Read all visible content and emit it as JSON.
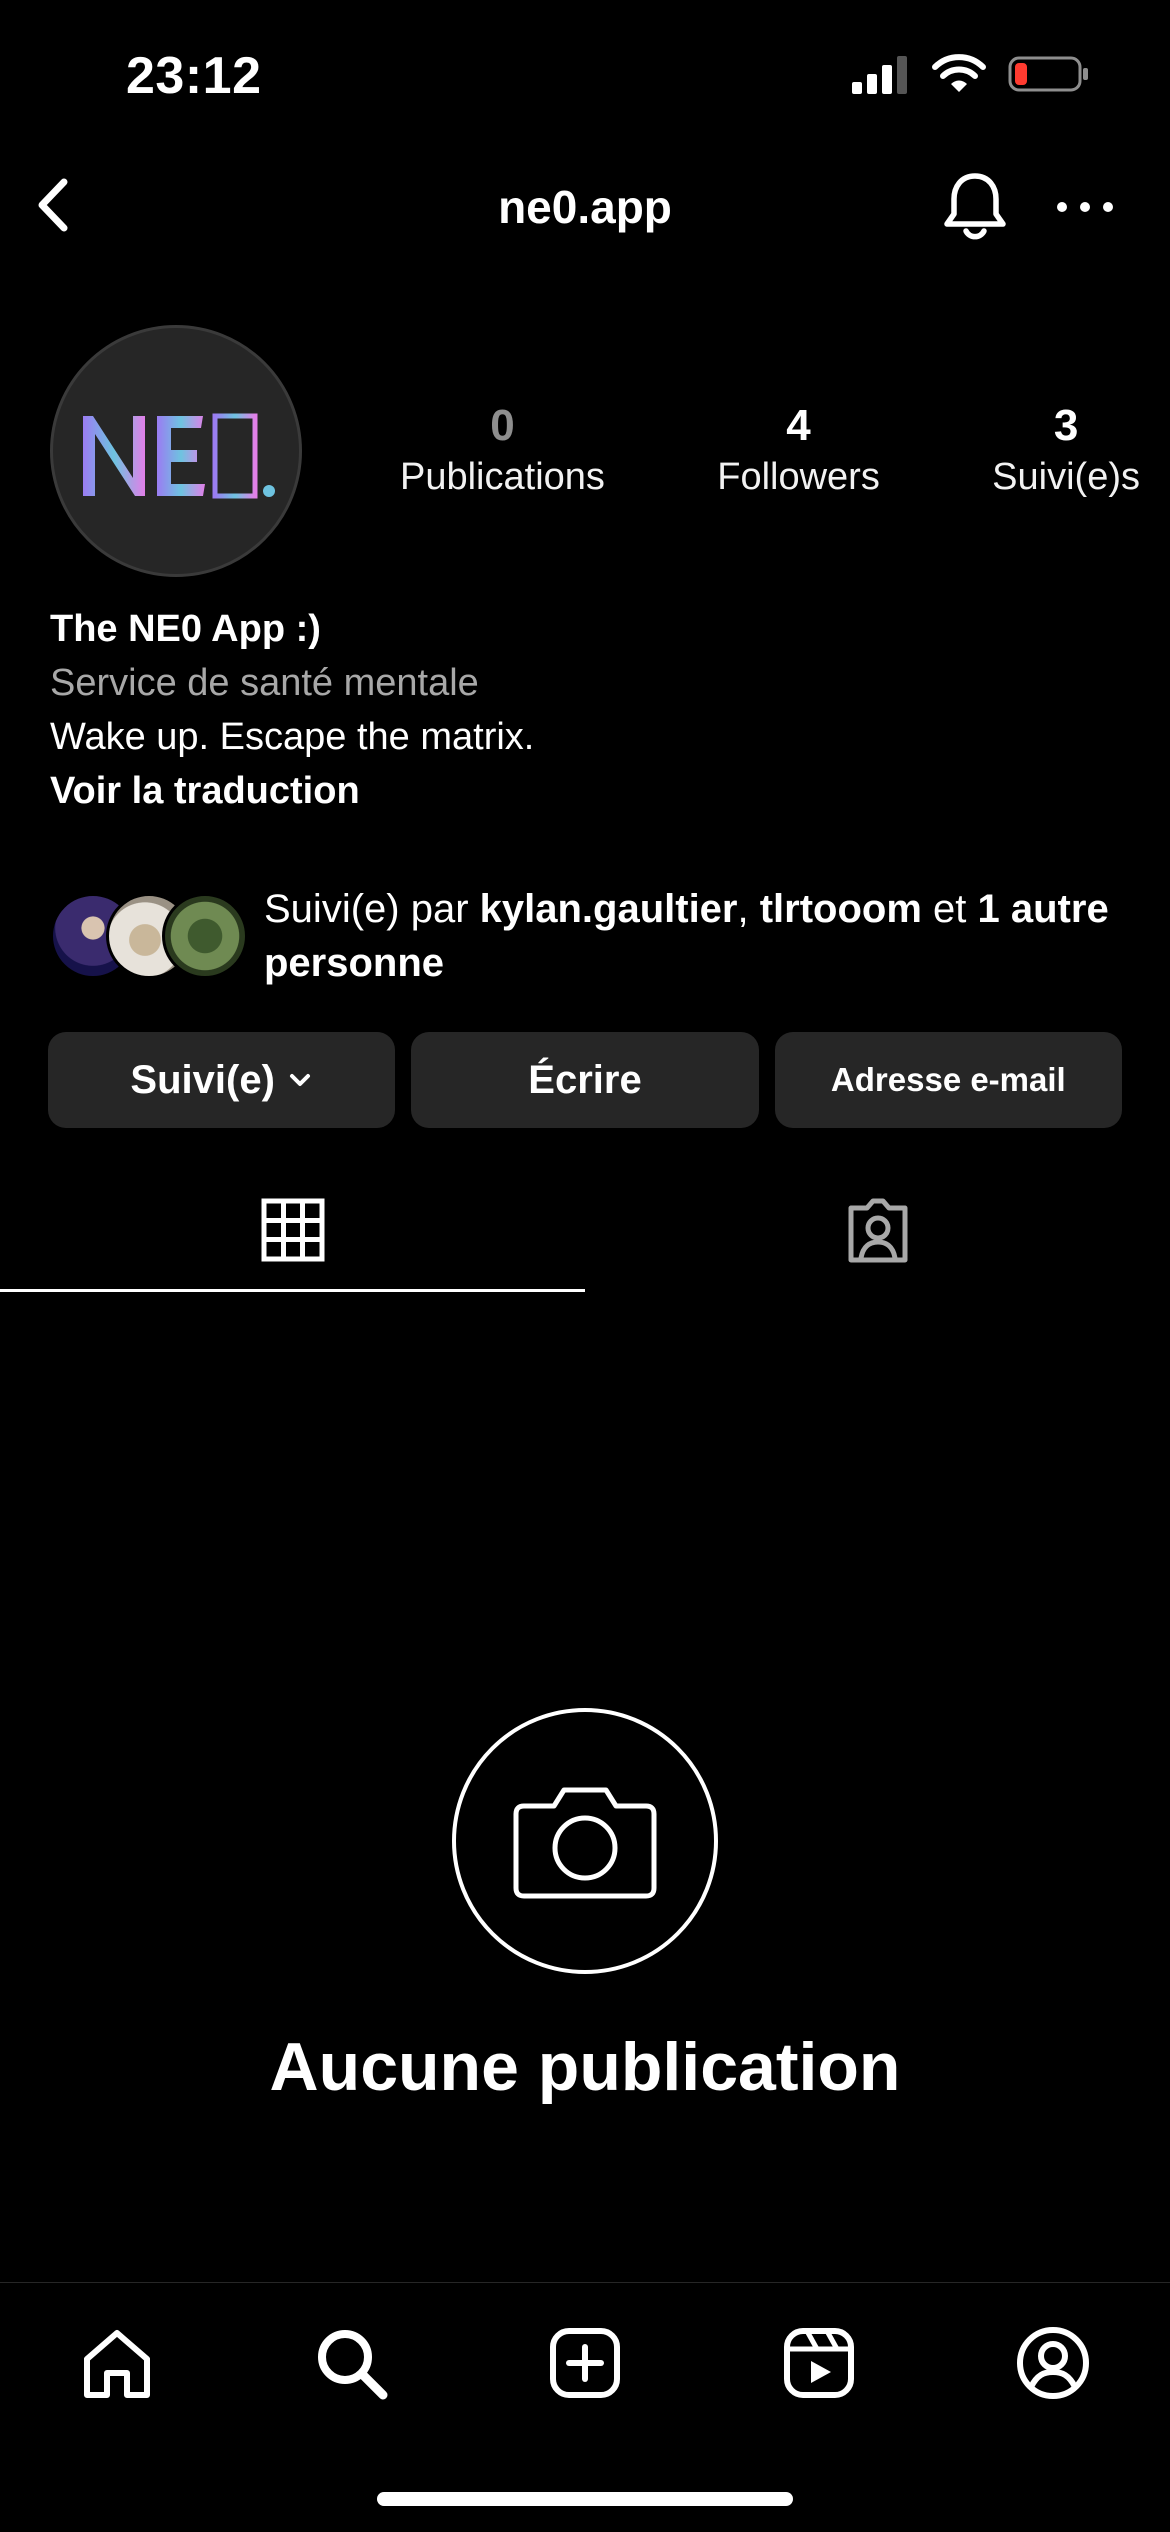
{
  "status_bar": {
    "time": "23:12"
  },
  "header": {
    "title": "ne0.app"
  },
  "profile": {
    "avatar_text": "NE0.",
    "stats": [
      {
        "value": "0",
        "label": "Publications"
      },
      {
        "value": "4",
        "label": "Followers"
      },
      {
        "value": "3",
        "label": "Suivi(e)s"
      }
    ],
    "bio": {
      "name": "The NE0 App :)",
      "category": "Service de santé mentale",
      "text": "Wake up. Escape the matrix.",
      "translate": "Voir la traduction"
    },
    "followed_by": {
      "prefix": "Suivi(e) par ",
      "user1": "kylan.gaultier",
      "sep": ", ",
      "user2": "tlrtooom",
      "mid": " et ",
      "others": "1 autre personne"
    }
  },
  "buttons": {
    "following": "Suivi(e)",
    "message": "Écrire",
    "email": "Adresse e-mail"
  },
  "empty_state": {
    "title": "Aucune publication"
  },
  "colors": {
    "background": "#000000",
    "button": "#262626",
    "muted": "#8e8e8e",
    "battery_low": "#ff3b30"
  }
}
